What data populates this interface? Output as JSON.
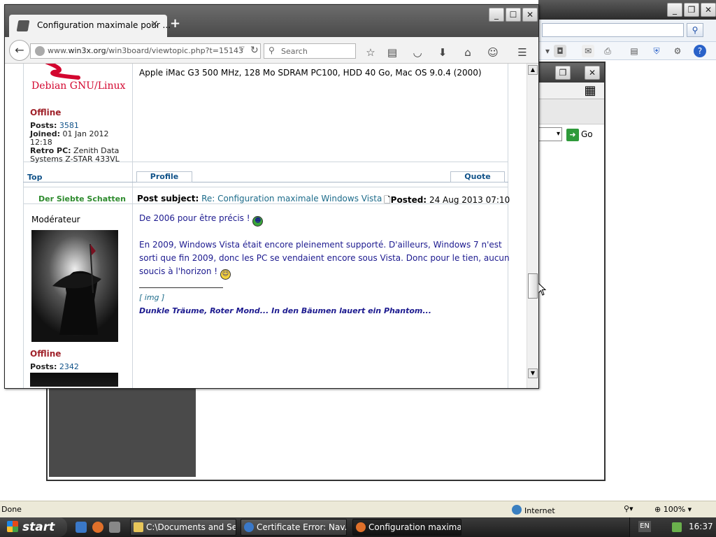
{
  "firefox": {
    "tab_title": "Configuration maximale pour ...",
    "url_prefix": "www.",
    "url_host": "win3x.org",
    "url_path": "/win3board/viewtopic.php?t=15143",
    "search_placeholder": "Search"
  },
  "post1": {
    "signature_line": "Apple iMac G3 500 MHz, 128 Mo SDRAM PC100, HDD 40 Go, Mac OS 9.0.4 (2000)",
    "logo_text": "Debian GNU/Linux",
    "status": "Offline",
    "posts_label": "Posts:",
    "posts_value": "3581",
    "joined_label": "Joined:",
    "joined_value": "01 Jan 2012",
    "joined_time": "12:18",
    "retro_label": "Retro PC:",
    "retro_value": "Zenith Data",
    "retro_value2": "Systems Z-STAR 433VL",
    "top_link": "Top",
    "profile_button": "Profile",
    "quote_button": "Quote"
  },
  "post2": {
    "author": "Der Siebte Schatten",
    "subject_label": "Post subject:",
    "subject": "Re: Configuration maximale Windows Vista",
    "posted_label": "Posted:",
    "posted_value": "24 Aug 2013 07:10",
    "rank": "Modérateur",
    "status": "Offline",
    "posts_label": "Posts:",
    "posts_value": "2342",
    "line1": "De 2006 pour être précis !",
    "para_a": "En 2009, Windows Vista était encore pleinement supporté. D'ailleurs, Windows 7 n'est",
    "para_b": "sorti que fin 2009, donc les PC se vendaient encore sous Vista. Donc pour le tien, aucun",
    "para_c": "soucis à l'horizon !",
    "img_tag": "[ img ]",
    "signature": "Dunkle Träume, Roter Mond... In den Bäumen lauert ein Phantom..."
  },
  "ie_dialog": {
    "go_label": "Go"
  },
  "statusbar": {
    "text": "Done",
    "zone": "Internet",
    "zoom": "100%"
  },
  "taskbar": {
    "start_label": "start",
    "tasks": [
      {
        "label": "C:\\Documents and Se..."
      },
      {
        "label": "Certificate Error: Nav..."
      },
      {
        "label": "Configuration maxima..."
      }
    ],
    "lang": "EN",
    "clock": "16:37"
  },
  "colors": {
    "accent_green": "#2e8b2e",
    "offline_red": "#a0232b",
    "link_blue": "#105289",
    "post_text": "#1c1a8f"
  }
}
